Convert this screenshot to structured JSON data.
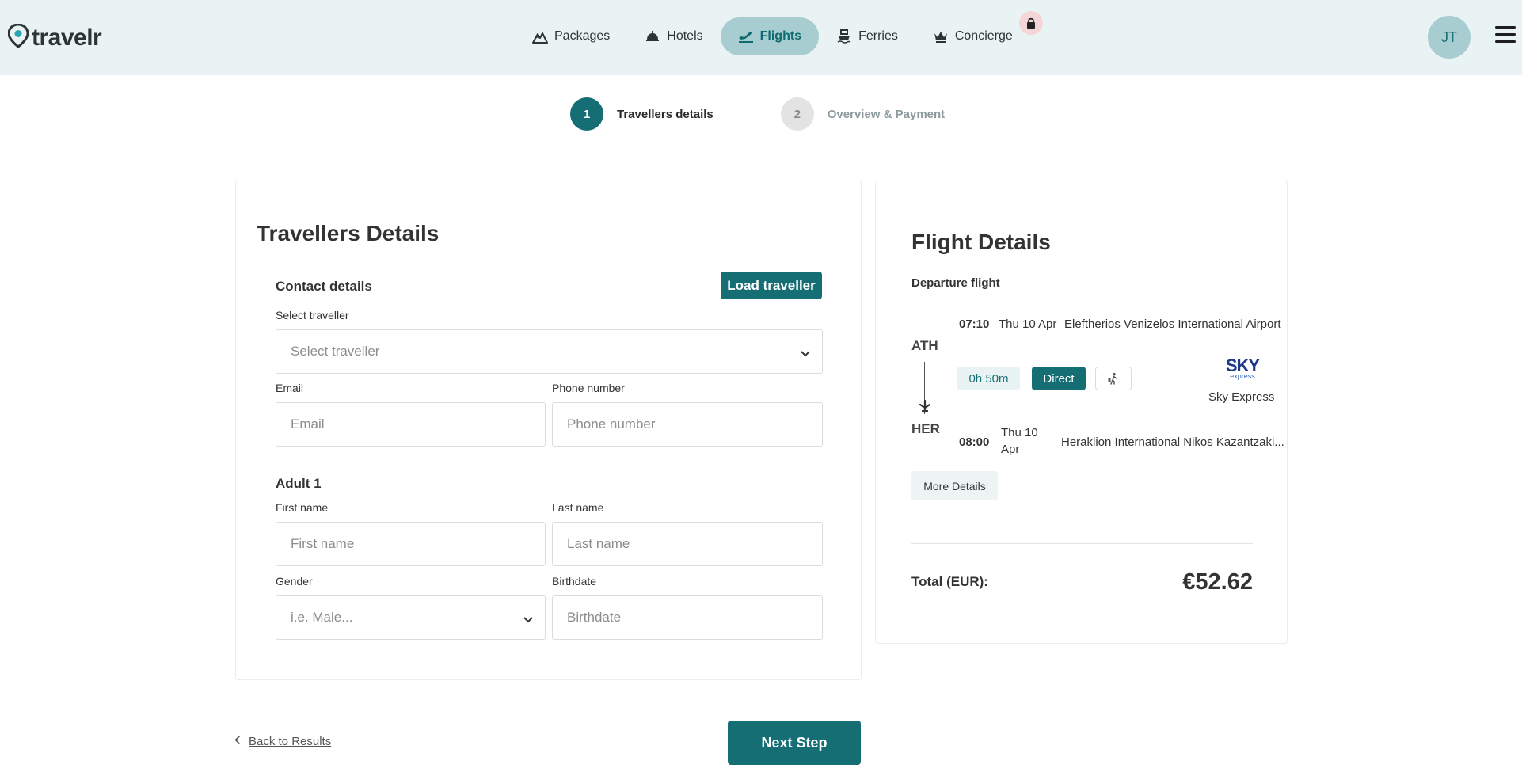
{
  "header": {
    "logo_text": "travelr",
    "nav": [
      {
        "label": "Packages",
        "icon": "mountain-icon"
      },
      {
        "label": "Hotels",
        "icon": "service-bell-icon"
      },
      {
        "label": "Flights",
        "icon": "airplane-icon",
        "active": true
      },
      {
        "label": "Ferries",
        "icon": "ship-icon"
      },
      {
        "label": "Concierge",
        "icon": "crown-icon",
        "badge": "lock-icon"
      }
    ],
    "avatar_initials": "JT"
  },
  "stepper": {
    "steps": [
      {
        "number": "1",
        "label": "Travellers details",
        "active": true
      },
      {
        "number": "2",
        "label": "Overview & Payment",
        "active": false
      }
    ]
  },
  "travellers": {
    "title": "Travellers Details",
    "contact": {
      "title": "Contact details",
      "load_button": "Load traveller",
      "select_label": "Select traveller",
      "select_placeholder": "Select traveller",
      "email_label": "Email",
      "email_placeholder": "Email",
      "phone_label": "Phone number",
      "phone_placeholder": "Phone number"
    },
    "adult": {
      "title": "Adult 1",
      "first_name_label": "First name",
      "first_name_placeholder": "First name",
      "last_name_label": "Last name",
      "last_name_placeholder": "Last name",
      "gender_label": "Gender",
      "gender_placeholder": "i.e. Male...",
      "birthdate_label": "Birthdate",
      "birthdate_placeholder": "Birthdate"
    }
  },
  "flight": {
    "title": "Flight Details",
    "subtitle": "Departure flight",
    "departure": {
      "code": "ATH",
      "time": "07:10",
      "date": "Thu 10 Apr",
      "airport": "Eleftherios Venizelos International Airport"
    },
    "arrival": {
      "code": "HER",
      "time": "08:00",
      "date_line1": "Thu 10",
      "date_line2": "Apr",
      "airport": "Heraklion International Nikos Kazantzaki..."
    },
    "duration": "0h 50m",
    "stops": "Direct",
    "airline_logo_top": "SKY",
    "airline_logo_bottom": "express",
    "airline": "Sky Express",
    "more_button": "More Details",
    "total_label": "Total (EUR):",
    "total_value": "€52.62"
  },
  "footer": {
    "back_label": "Back to Results",
    "next_label": "Next Step"
  },
  "colors": {
    "primary": "#166e75",
    "header_bg": "#eaf3f3",
    "nav_active_bg": "#a7cdd1"
  }
}
